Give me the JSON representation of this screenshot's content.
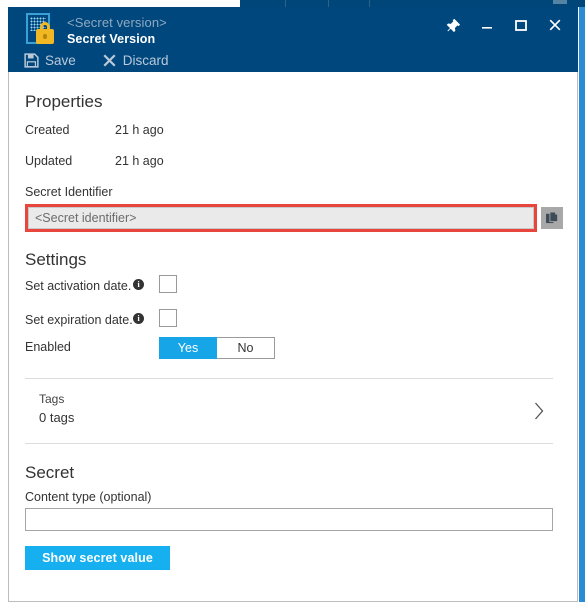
{
  "window": {
    "subtitle": "<Secret version>",
    "title": "Secret Version",
    "icon": "key-vault-secret-icon",
    "controls": {
      "pin": "Pin",
      "minimize": "Minimize",
      "maximize": "Maximize",
      "close": "Close"
    }
  },
  "toolbar": {
    "save_label": "Save",
    "discard_label": "Discard"
  },
  "properties": {
    "heading": "Properties",
    "rows": [
      {
        "label": "Created",
        "value": "21 h ago"
      },
      {
        "label": "Updated",
        "value": "21 h ago"
      }
    ],
    "secret_identifier": {
      "label": "Secret Identifier",
      "value": "<Secret identifier>",
      "placeholder": "<Secret identifier>",
      "copy_button": "Copy to clipboard"
    }
  },
  "settings": {
    "heading": "Settings",
    "activation": {
      "label": "Set activation date.",
      "info": "i",
      "checked": false
    },
    "expiration": {
      "label": "Set expiration date.",
      "info": "i",
      "checked": false
    },
    "enabled": {
      "label": "Enabled",
      "yes": "Yes",
      "no": "No",
      "selected": "Yes"
    }
  },
  "tags": {
    "title": "Tags",
    "count_label": "0 tags"
  },
  "secret": {
    "heading": "Secret",
    "content_type_label": "Content type (optional)",
    "content_type_value": "",
    "content_type_placeholder": "",
    "show_button": "Show secret value"
  },
  "colors": {
    "titlebar": "#00477e",
    "accent_blue": "#16b0f0",
    "toggle_on": "#16a6e8",
    "highlight_red": "#e8453c",
    "scroll_accent": "#2a8cd4"
  }
}
